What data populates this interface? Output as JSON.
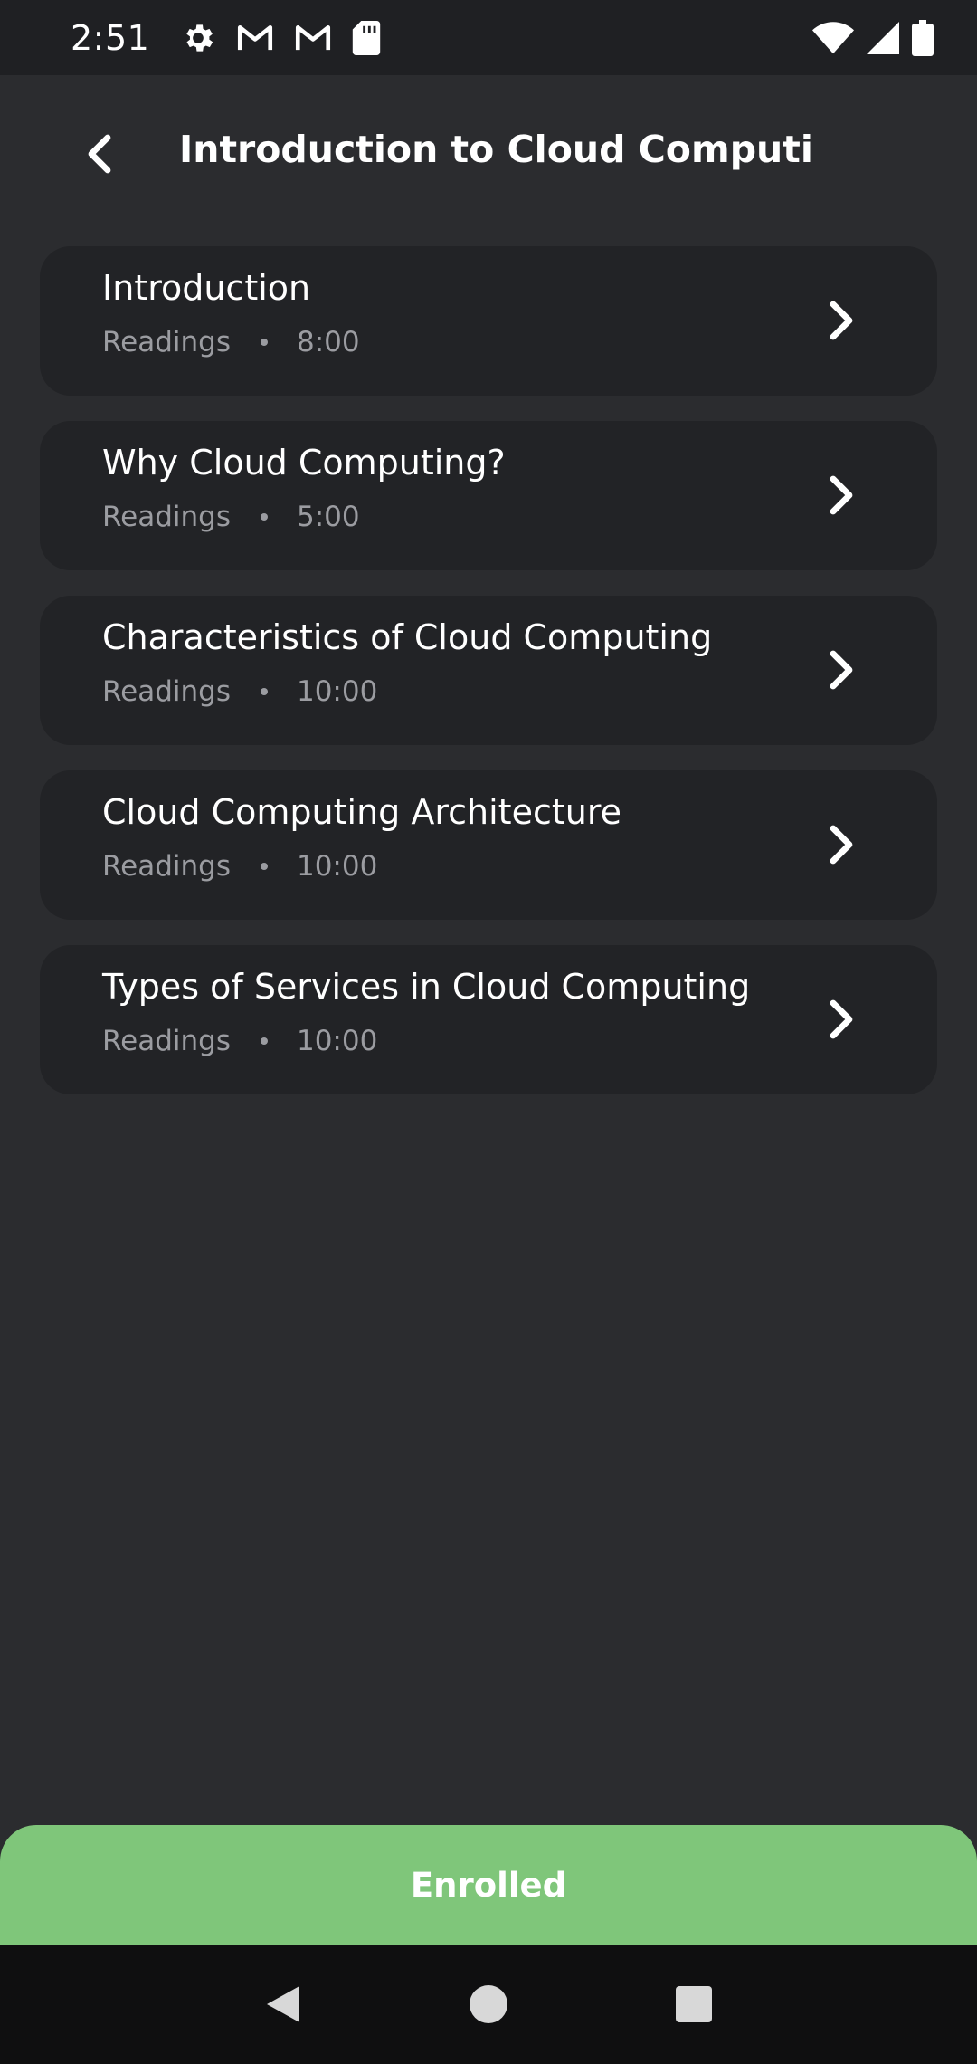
{
  "status_bar": {
    "time": "2:51",
    "left_icons": [
      "gear-icon",
      "gmail-icon",
      "gmail-icon",
      "sd-card-icon"
    ],
    "right_icons": [
      "wifi-icon",
      "signal-icon",
      "battery-icon"
    ]
  },
  "header": {
    "title": "Introduction to Cloud Computin..."
  },
  "lessons": [
    {
      "title": "Introduction",
      "type": "Readings",
      "duration": "8:00"
    },
    {
      "title": "Why Cloud Computing?",
      "type": "Readings",
      "duration": "5:00"
    },
    {
      "title": "Characteristics of Cloud Computing",
      "type": "Readings",
      "duration": "10:00"
    },
    {
      "title": "Cloud Computing Architecture",
      "type": "Readings",
      "duration": "10:00"
    },
    {
      "title": "Types of Services in Cloud Computing",
      "type": "Readings",
      "duration": "10:00"
    }
  ],
  "enrolled": {
    "label": "Enrolled",
    "color": "#7fc67a"
  },
  "nav_bar": {
    "buttons": [
      "back-triangle-icon",
      "home-circle-icon",
      "recents-square-icon"
    ]
  }
}
